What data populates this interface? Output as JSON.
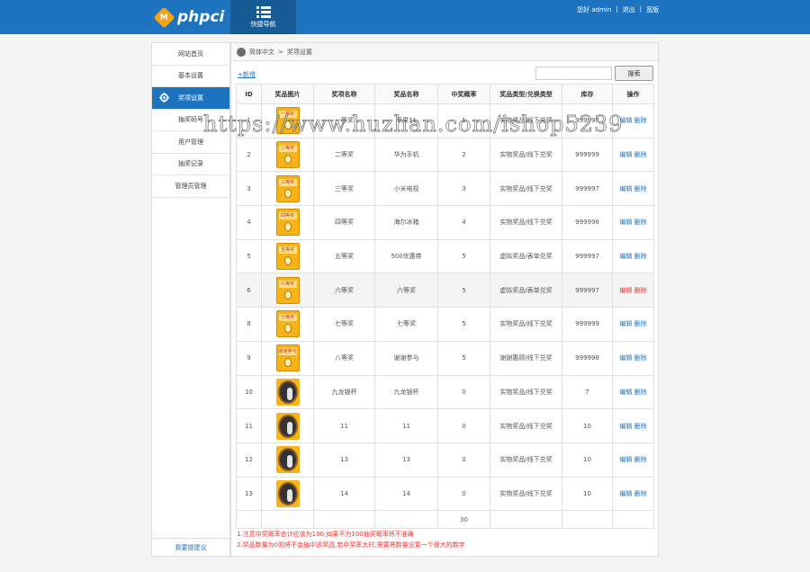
{
  "header": {
    "logo_badge": "M",
    "logo_text": "phpci",
    "quicknav_label": "快捷导航",
    "greeting": "您好 admin",
    "logout": "退出",
    "wide": "宽版"
  },
  "sidebar": {
    "items": [
      {
        "label": "网站首页"
      },
      {
        "label": "基本设置"
      },
      {
        "label": "奖项设置"
      },
      {
        "label": "抽奖码号"
      },
      {
        "label": "用户管理"
      },
      {
        "label": "抽奖记录"
      },
      {
        "label": "管理员管理"
      }
    ],
    "feedback": "我要提建议"
  },
  "breadcrumb": {
    "root": "简体中文",
    "sep": ">",
    "current": "奖项设置"
  },
  "toolbar": {
    "add_label": "+新增",
    "search_placeholder": "",
    "search_label": "搜索"
  },
  "table": {
    "headers": [
      "ID",
      "奖品图片",
      "奖项名称",
      "奖品名称",
      "中奖概率",
      "奖品类型/兑换类型",
      "库存",
      "操作"
    ],
    "rows": [
      {
        "id": "1",
        "icon": "chest",
        "tag": "一等奖",
        "level": "一等奖",
        "prize": "苹果11",
        "prob": "1",
        "type": "实物奖品/线下兑奖",
        "stock": "999998",
        "edit": "编辑",
        "del": "删除"
      },
      {
        "id": "2",
        "icon": "chest",
        "tag": "二等奖",
        "level": "二等奖",
        "prize": "华为手机",
        "prob": "2",
        "type": "实物奖品/线下兑奖",
        "stock": "999999",
        "edit": "编辑",
        "del": "删除"
      },
      {
        "id": "3",
        "icon": "chest",
        "tag": "三等奖",
        "level": "三等奖",
        "prize": "小米电视",
        "prob": "3",
        "type": "实物奖品/线下兑奖",
        "stock": "999997",
        "edit": "编辑",
        "del": "删除"
      },
      {
        "id": "4",
        "icon": "chest",
        "tag": "四等奖",
        "level": "四等奖",
        "prize": "海尔冰箱",
        "prob": "4",
        "type": "实物奖品/线下兑奖",
        "stock": "999998",
        "edit": "编辑",
        "del": "删除"
      },
      {
        "id": "5",
        "icon": "chest",
        "tag": "五等奖",
        "level": "五等奖",
        "prize": "500优惠券",
        "prob": "5",
        "type": "虚拟奖品/表单兑奖",
        "stock": "999997",
        "edit": "编辑",
        "del": "删除"
      },
      {
        "id": "6",
        "icon": "chest",
        "tag": "六等奖",
        "level": "六等奖",
        "prize": "六等奖",
        "prob": "5",
        "type": "虚拟奖品/表单兑奖",
        "stock": "999997",
        "edit": "编辑",
        "del": "删除",
        "highlight": true
      },
      {
        "id": "8",
        "icon": "chest",
        "tag": "七等奖",
        "level": "七等奖",
        "prize": "七等奖",
        "prob": "5",
        "type": "实物奖品/线下兑奖",
        "stock": "999999",
        "edit": "编辑",
        "del": "删除"
      },
      {
        "id": "9",
        "icon": "chest",
        "tag": "谢谢参与",
        "level": "八等奖",
        "prize": "谢谢参与",
        "prob": "5",
        "type": "谢谢惠顾/线下兑奖",
        "stock": "999998",
        "edit": "编辑",
        "del": "删除"
      },
      {
        "id": "10",
        "icon": "cup",
        "tag": "",
        "level": "九龙银杯",
        "prize": "九龙银杯",
        "prob": "0",
        "type": "实物奖品/线下兑奖",
        "stock": "7",
        "edit": "编辑",
        "del": "删除"
      },
      {
        "id": "11",
        "icon": "cup",
        "tag": "",
        "level": "11",
        "prize": "11",
        "prob": "0",
        "type": "实物奖品/线下兑奖",
        "stock": "10",
        "edit": "编辑",
        "del": "删除"
      },
      {
        "id": "12",
        "icon": "cup",
        "tag": "",
        "level": "13",
        "prize": "13",
        "prob": "0",
        "type": "实物奖品/线下兑奖",
        "stock": "10",
        "edit": "编辑",
        "del": "删除"
      },
      {
        "id": "13",
        "icon": "cup",
        "tag": "",
        "level": "14",
        "prize": "14",
        "prob": "0",
        "type": "实物奖品/线下兑奖",
        "stock": "10",
        "edit": "编辑",
        "del": "删除"
      }
    ],
    "total_prob": "30"
  },
  "notes": [
    "1.注意中奖概率合计应该为100;如果不为100抽奖概率将不准确",
    "2.奖品数量为0则将不会抽中该奖品,若中奖率太时,需要将数量设置一个很大的数字"
  ],
  "watermark": "https://www.huzhan.com/ishop5239",
  "colors": {
    "primary": "#1e73be",
    "primary_dark": "#165a96",
    "danger": "#e53935",
    "prize_gold": "#f6b419"
  }
}
